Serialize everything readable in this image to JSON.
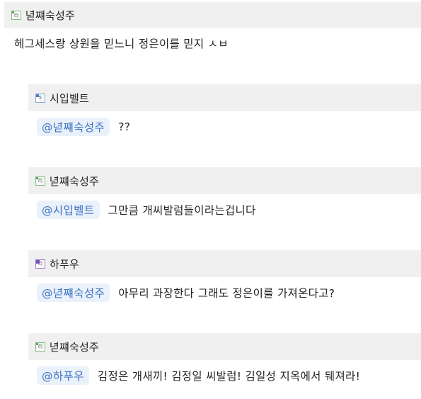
{
  "post": {
    "author": "녇쨰숙성주",
    "author_level_icon": "level-badge-icon",
    "body": "헤그세스랑 상원을 믿느니 정은이를 믿지 ㅅㅂ"
  },
  "replies": [
    {
      "author": "시입벨트",
      "level_color": "blue",
      "mention": "@녇쨰숙성주",
      "text": "??"
    },
    {
      "author": "녇쨰숙성주",
      "level_color": "green",
      "mention": "@시입벨트",
      "text": "그만큼 개씨발럼들이라는겁니다"
    },
    {
      "author": "하푸우",
      "level_color": "purple",
      "mention": "@녇쨰숙성주",
      "text": "아무리 과장한다 그래도 정은이를 가져온다고?"
    },
    {
      "author": "녇쨰숙성주",
      "level_color": "green",
      "mention": "@하푸우",
      "text": "김정은 개새끼! 김정일 씨발럼! 김일성 지옥에서 뒈져라!"
    }
  ]
}
